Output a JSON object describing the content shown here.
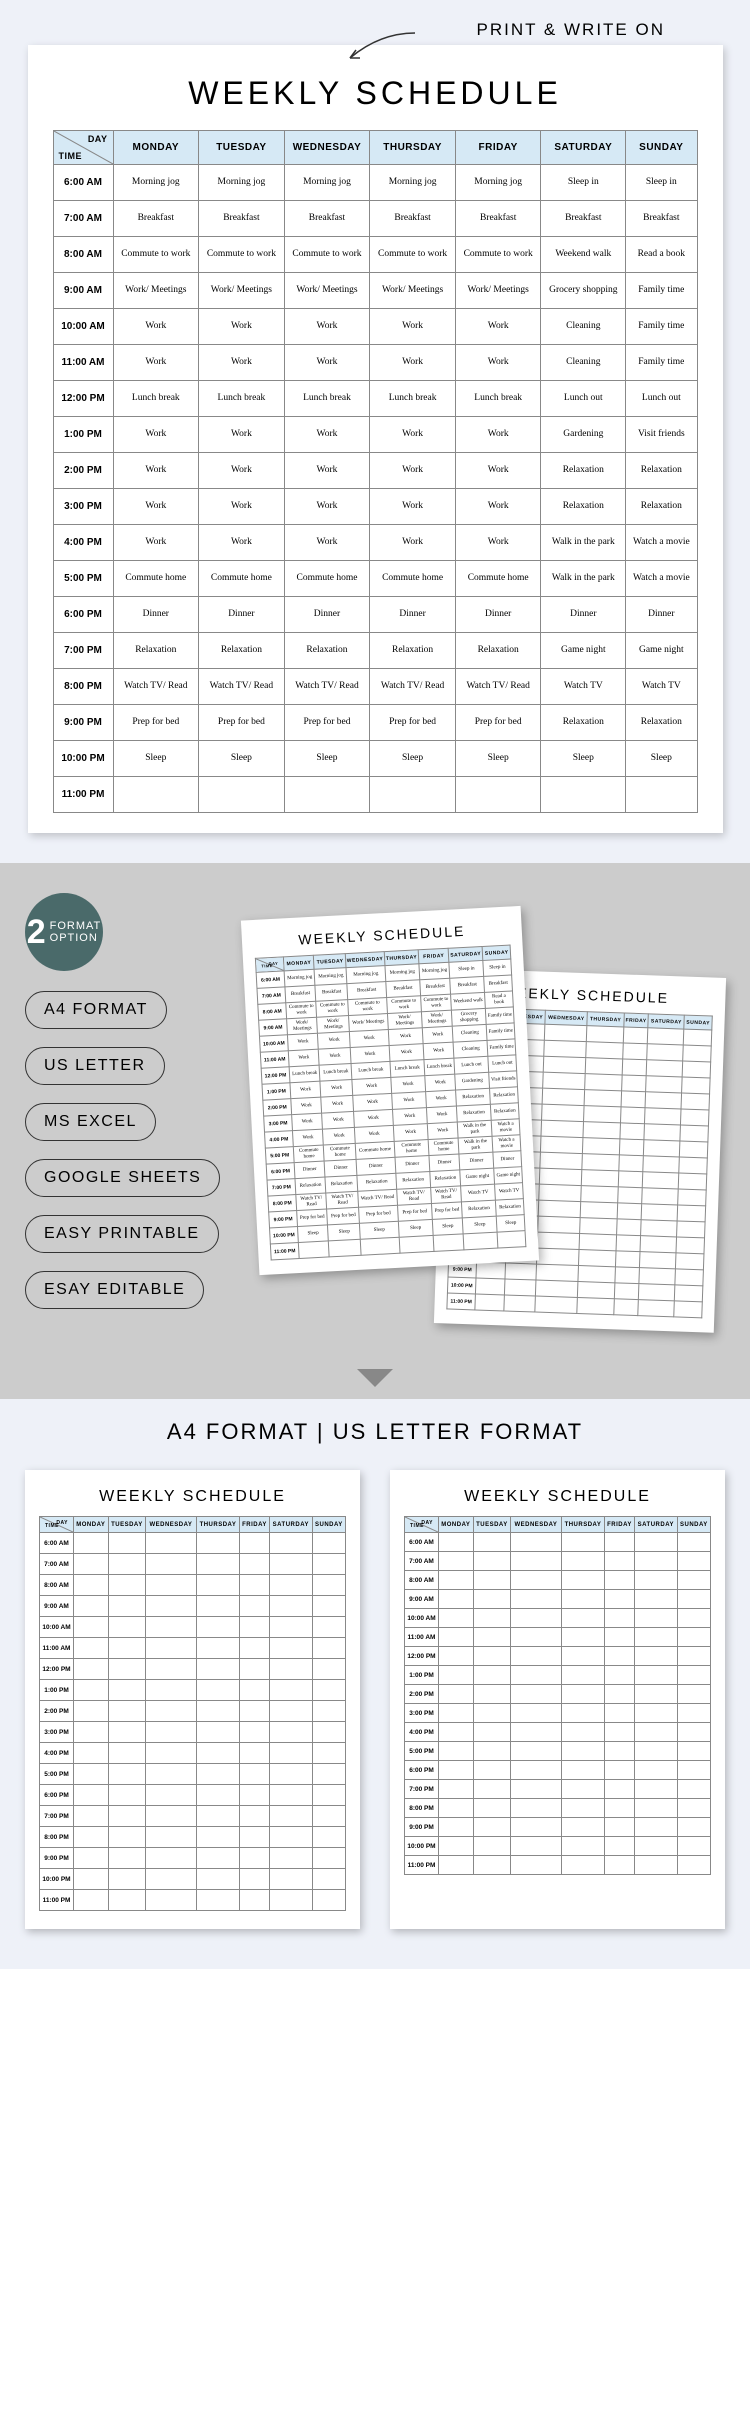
{
  "callout": "PRINT & WRITE ON",
  "title": "WEEKLY SCHEDULE",
  "corner": {
    "day": "DAY",
    "time": "TIME"
  },
  "days": [
    "MONDAY",
    "TUESDAY",
    "WEDNESDAY",
    "THURSDAY",
    "FRIDAY",
    "SATURDAY",
    "SUNDAY"
  ],
  "times": [
    "6:00 AM",
    "7:00 AM",
    "8:00 AM",
    "9:00 AM",
    "10:00 AM",
    "11:00 AM",
    "12:00 PM",
    "1:00 PM",
    "2:00 PM",
    "3:00 PM",
    "4:00 PM",
    "5:00 PM",
    "6:00 PM",
    "7:00 PM",
    "8:00 PM",
    "9:00 PM",
    "10:00 PM",
    "11:00 PM"
  ],
  "cells": [
    [
      "Morning jog",
      "Morning jog",
      "Morning jog",
      "Morning jog",
      "Morning jog",
      "Sleep in",
      "Sleep in"
    ],
    [
      "Breakfast",
      "Breakfast",
      "Breakfast",
      "Breakfast",
      "Breakfast",
      "Breakfast",
      "Breakfast"
    ],
    [
      "Commute to work",
      "Commute to work",
      "Commute to work",
      "Commute to work",
      "Commute to work",
      "Weekend walk",
      "Read a book"
    ],
    [
      "Work/ Meetings",
      "Work/ Meetings",
      "Work/ Meetings",
      "Work/ Meetings",
      "Work/ Meetings",
      "Grocery shopping",
      "Family time"
    ],
    [
      "Work",
      "Work",
      "Work",
      "Work",
      "Work",
      "Cleaning",
      "Family time"
    ],
    [
      "Work",
      "Work",
      "Work",
      "Work",
      "Work",
      "Cleaning",
      "Family time"
    ],
    [
      "Lunch break",
      "Lunch break",
      "Lunch break",
      "Lunch break",
      "Lunch break",
      "Lunch out",
      "Lunch out"
    ],
    [
      "Work",
      "Work",
      "Work",
      "Work",
      "Work",
      "Gardening",
      "Visit friends"
    ],
    [
      "Work",
      "Work",
      "Work",
      "Work",
      "Work",
      "Relaxation",
      "Relaxation"
    ],
    [
      "Work",
      "Work",
      "Work",
      "Work",
      "Work",
      "Relaxation",
      "Relaxation"
    ],
    [
      "Work",
      "Work",
      "Work",
      "Work",
      "Work",
      "Walk in the park",
      "Watch a movie"
    ],
    [
      "Commute home",
      "Commute home",
      "Commute home",
      "Commute home",
      "Commute home",
      "Walk in the park",
      "Watch a movie"
    ],
    [
      "Dinner",
      "Dinner",
      "Dinner",
      "Dinner",
      "Dinner",
      "Dinner",
      "Dinner"
    ],
    [
      "Relaxation",
      "Relaxation",
      "Relaxation",
      "Relaxation",
      "Relaxation",
      "Game night",
      "Game night"
    ],
    [
      "Watch TV/ Read",
      "Watch TV/ Read",
      "Watch TV/ Read",
      "Watch TV/ Read",
      "Watch TV/ Read",
      "Watch TV",
      "Watch TV"
    ],
    [
      "Prep for bed",
      "Prep for bed",
      "Prep for bed",
      "Prep for bed",
      "Prep for bed",
      "Relaxation",
      "Relaxation"
    ],
    [
      "Sleep",
      "Sleep",
      "Sleep",
      "Sleep",
      "Sleep",
      "Sleep",
      "Sleep"
    ],
    [
      "",
      "",
      "",
      "",
      "",
      "",
      ""
    ]
  ],
  "badge": {
    "num": "2",
    "line1": "FORMAT",
    "line2": "OPTION"
  },
  "pills": [
    "A4 FORMAT",
    "US LETTER",
    "MS EXCEL",
    "GOOGLE SHEETS",
    "EASY PRINTABLE",
    "ESAY EDITABLE"
  ],
  "sec3_title": "A4 FORMAT | US LETTER FORMAT"
}
